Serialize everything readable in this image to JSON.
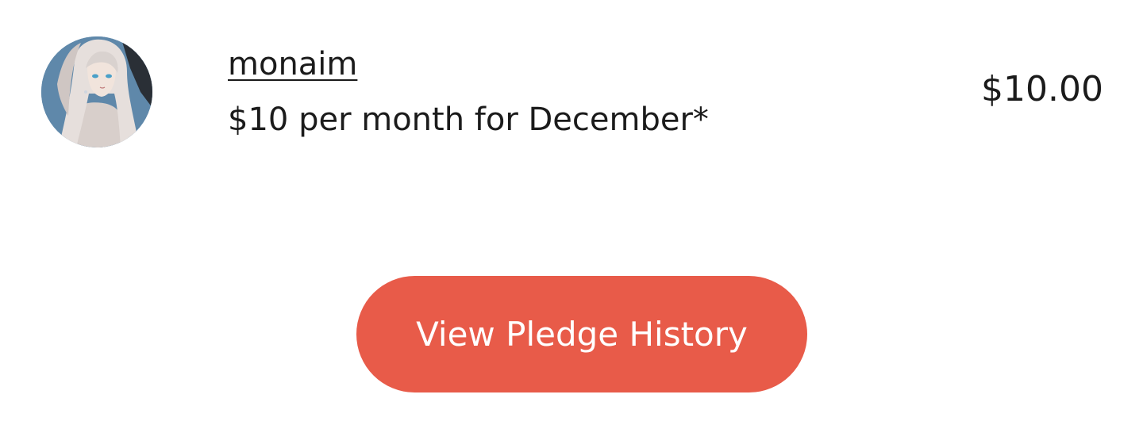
{
  "pledge": {
    "creator_name": "monaim",
    "description": "$10 per month for December*",
    "amount": "$10.00",
    "avatar_icon": "creator-avatar-anime-character"
  },
  "actions": {
    "view_history_label": "View Pledge History"
  },
  "colors": {
    "button_background": "#e85b49",
    "button_text": "#ffffff",
    "text": "#1b1b1b",
    "page_background": "#ffffff"
  }
}
